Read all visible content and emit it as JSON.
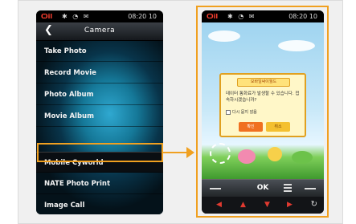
{
  "colors": {
    "highlight": "#f0a020",
    "menu_glow": "#2fa8d0",
    "dialog_bg": "#fff7c8",
    "nav_icon": "#e03a30"
  },
  "left_phone": {
    "status": {
      "signal": "Ѻil",
      "icons": "✱ ◔ ✉",
      "clock": "08:20 10"
    },
    "title": "Camera",
    "back_glyph": "❮",
    "menu_items": [
      {
        "label": "Take Photo",
        "selected": false
      },
      {
        "label": "Record Movie",
        "selected": false
      },
      {
        "label": "Photo Album",
        "selected": false
      },
      {
        "label": "Movie Album",
        "selected": false
      },
      {
        "label": "Mobile Cyworld",
        "selected": true
      },
      {
        "label": "NATE Photo Print",
        "selected": false
      },
      {
        "label": "Image Call",
        "selected": false
      }
    ]
  },
  "right_phone": {
    "status": {
      "signal": "Ѻil",
      "icons": "✱ ◔ ✉",
      "clock": "08:20 10"
    },
    "dialog": {
      "title": "모바일싸이월드",
      "body": "데이터 통화료가 발생할 수 있습니다. 접속하시겠습니까?",
      "checkbox_label": "다시 묻지 않음",
      "buttons": [
        "확인",
        "취소"
      ]
    },
    "softkey": {
      "center": "OK"
    },
    "nav_icons": [
      "◀",
      "▲",
      "▼",
      "▶"
    ],
    "rotate_icon": "↻"
  }
}
